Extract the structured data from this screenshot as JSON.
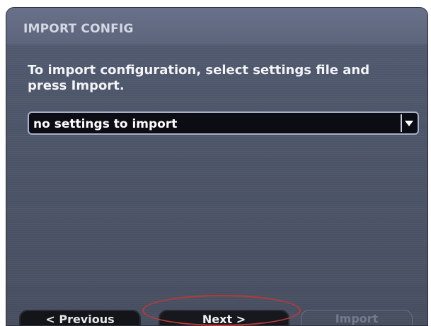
{
  "header": {
    "title": "IMPORT CONFIG"
  },
  "main": {
    "instructions": "To import configuration, select settings file and press Import.",
    "settings_select": {
      "value": "no settings to import",
      "arrow_icon": "triangle-down-icon"
    }
  },
  "footer": {
    "previous_label": "< Previous",
    "next_label": "Next >",
    "import_label": "Import"
  },
  "colors": {
    "screen_background": "#4c5468",
    "header_background": "#636b82",
    "dropdown_background": "#0c0d14",
    "highlight_ring": "#b73a3a",
    "disabled_text": "#737a8d"
  }
}
